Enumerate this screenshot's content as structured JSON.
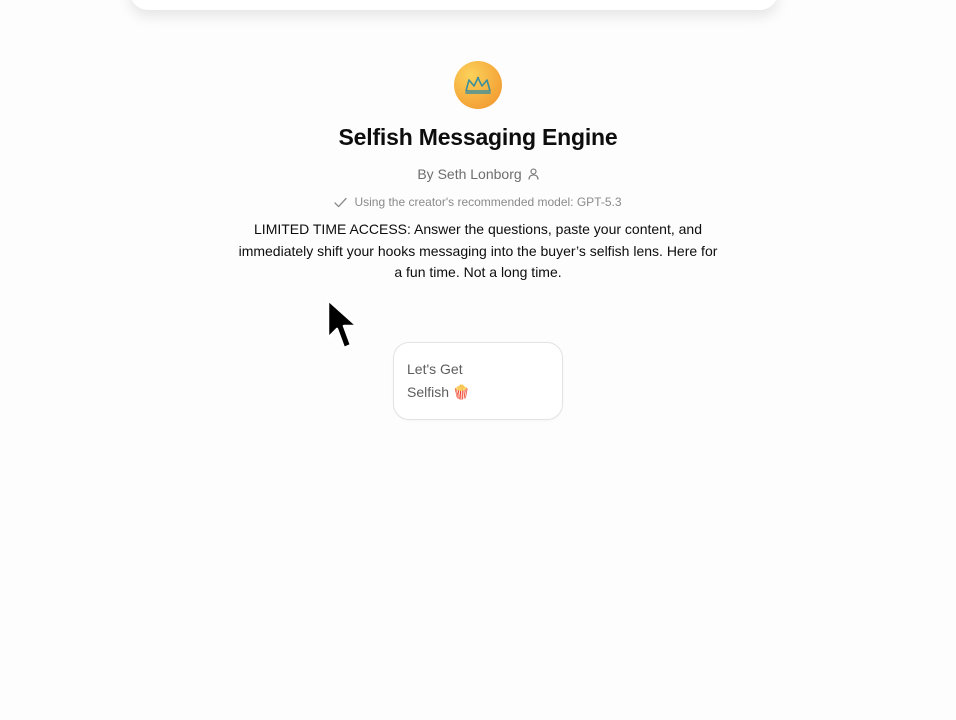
{
  "gpt": {
    "icon": "crown-icon",
    "name": "Selfish Messaging Engine",
    "author": "By Seth Lonborg",
    "author_icon": "user-icon",
    "model_note": "Using the creator's recommended model: GPT-5.3",
    "model_icon": "check-icon",
    "description": "LIMITED TIME ACCESS: Answer the questions, paste your content, and immediately shift your hooks messaging into the buyer’s selfish lens. Here for a fun time. Not a long time."
  },
  "conversation_starters": [
    {
      "label": "Let's Get Selfish 🍿"
    }
  ],
  "colors": {
    "avatar_gradient_start": "#fbd25a",
    "avatar_gradient_end": "#f0912b",
    "text_primary": "#0d0d0d",
    "text_secondary": "#6e6e6e"
  }
}
